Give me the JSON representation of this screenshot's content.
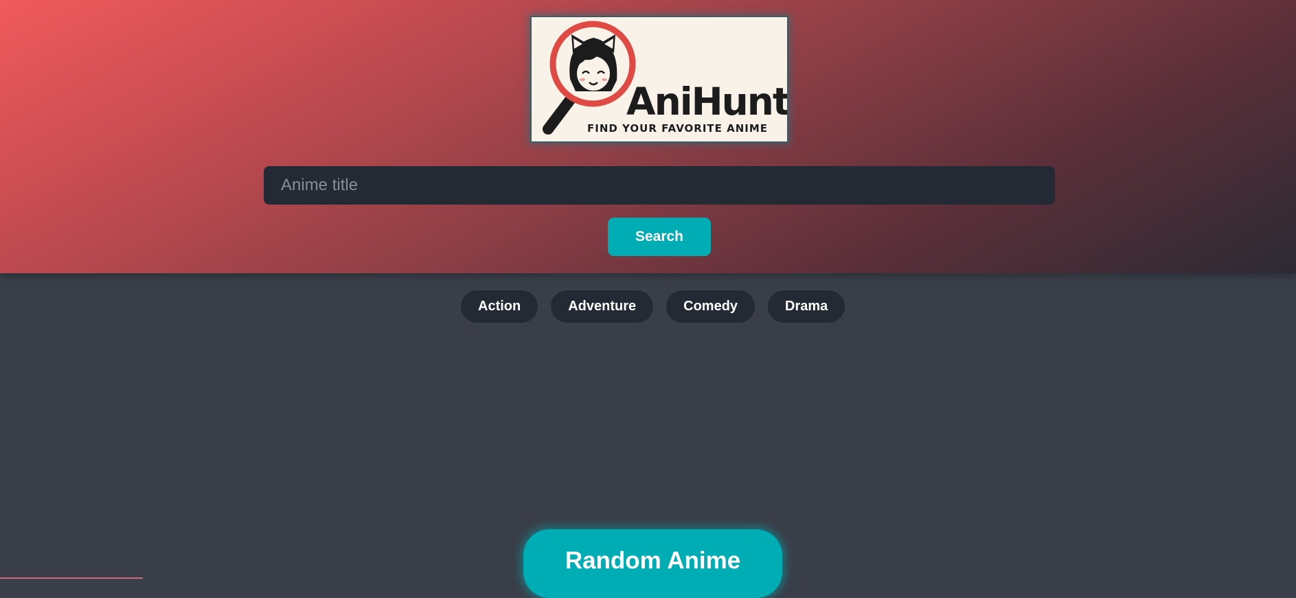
{
  "logo": {
    "title": "AniHunt",
    "tagline": "FIND YOUR FAVORITE ANIME",
    "icon": "magnifier-anime-girl-icon",
    "colors": {
      "ring": "#e04a44",
      "ink": "#1c1c1c",
      "background": "#f8f2e8"
    }
  },
  "search": {
    "placeholder": "Anime title",
    "value": "",
    "button_label": "Search"
  },
  "genres": [
    {
      "label": "Action"
    },
    {
      "label": "Adventure"
    },
    {
      "label": "Comedy"
    },
    {
      "label": "Drama"
    }
  ],
  "random_button_label": "Random Anime",
  "colors": {
    "accent": "#00adb5",
    "background": "#393e48",
    "surface": "#232a33",
    "hero_start": "#f05a5c",
    "hero_end": "#2c2a33"
  }
}
